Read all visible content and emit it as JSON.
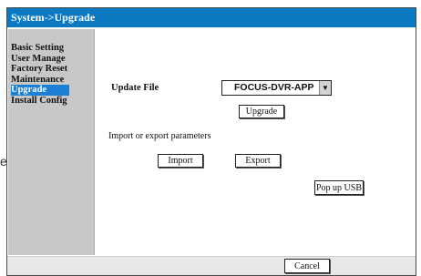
{
  "stray_glyph": "e",
  "window": {
    "title": "System->Upgrade"
  },
  "sidebar": {
    "items": [
      {
        "label": "Basic Setting",
        "active": false
      },
      {
        "label": "User Manage",
        "active": false
      },
      {
        "label": "Factory Reset",
        "active": false
      },
      {
        "label": "Maintenance",
        "active": false
      },
      {
        "label": "Upgrade",
        "active": true
      },
      {
        "label": "Install Config",
        "active": false
      }
    ]
  },
  "content": {
    "update_file_label": "Update File",
    "update_file_value": "FOCUS-DVR-APP",
    "upgrade_button": "Upgrade",
    "import_export_label": "Import or export parameters",
    "import_button": "Import",
    "export_button": "Export",
    "popup_usb_button": "Pop up USB"
  },
  "footer": {
    "cancel_button": "Cancel"
  },
  "colors": {
    "titlebar": "#0a79c2",
    "sidebar_bg": "#c8c8c8",
    "active_item": "#1c7fd6",
    "footer_bg": "#e8e8e8"
  },
  "icons": {
    "dropdown": "chevron-down-icon"
  }
}
